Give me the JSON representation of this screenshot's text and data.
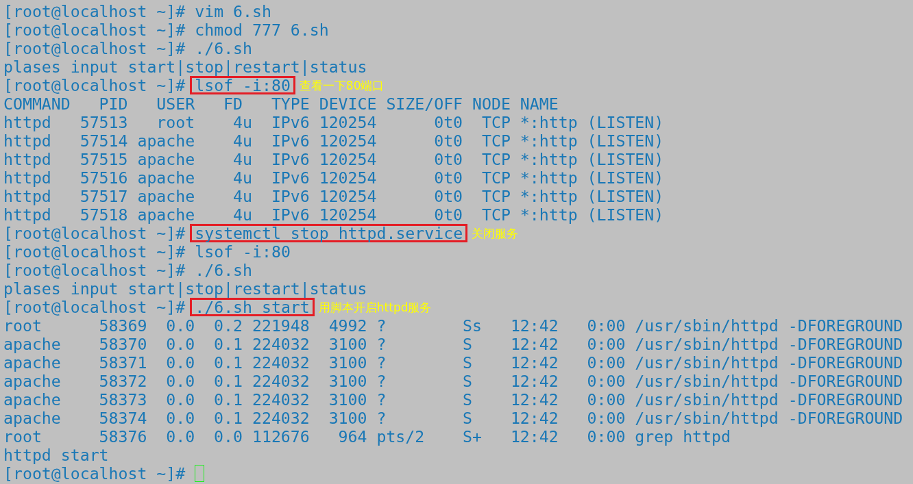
{
  "terminal": {
    "lines": [
      {
        "kind": "prompt",
        "prompt": "[root@localhost ~]#",
        "command": "vim 6.sh",
        "highlighted": false
      },
      {
        "kind": "prompt",
        "prompt": "[root@localhost ~]#",
        "command": "chmod 777 6.sh",
        "highlighted": false
      },
      {
        "kind": "prompt",
        "prompt": "[root@localhost ~]#",
        "command": "./6.sh",
        "highlighted": false
      },
      {
        "kind": "output",
        "text": "plases input start|stop|restart|status"
      },
      {
        "kind": "prompt",
        "prompt": "[root@localhost ~]#",
        "command": "lsof -i:80",
        "highlighted": true,
        "annotation": "查看一下80端口"
      },
      {
        "kind": "output",
        "text": "COMMAND   PID   USER   FD   TYPE DEVICE SIZE/OFF NODE NAME"
      },
      {
        "kind": "output",
        "text": "httpd   57513   root    4u  IPv6 120254      0t0  TCP *:http (LISTEN)"
      },
      {
        "kind": "output",
        "text": "httpd   57514 apache    4u  IPv6 120254      0t0  TCP *:http (LISTEN)"
      },
      {
        "kind": "output",
        "text": "httpd   57515 apache    4u  IPv6 120254      0t0  TCP *:http (LISTEN)"
      },
      {
        "kind": "output",
        "text": "httpd   57516 apache    4u  IPv6 120254      0t0  TCP *:http (LISTEN)"
      },
      {
        "kind": "output",
        "text": "httpd   57517 apache    4u  IPv6 120254      0t0  TCP *:http (LISTEN)"
      },
      {
        "kind": "output",
        "text": "httpd   57518 apache    4u  IPv6 120254      0t0  TCP *:http (LISTEN)"
      },
      {
        "kind": "prompt",
        "prompt": "[root@localhost ~]#",
        "command": "systemctl stop httpd.service",
        "highlighted": true,
        "annotation": "关闭服务"
      },
      {
        "kind": "prompt",
        "prompt": "[root@localhost ~]#",
        "command": "lsof -i:80",
        "highlighted": false
      },
      {
        "kind": "prompt",
        "prompt": "[root@localhost ~]#",
        "command": "./6.sh",
        "highlighted": false
      },
      {
        "kind": "output",
        "text": "plases input start|stop|restart|status"
      },
      {
        "kind": "prompt",
        "prompt": "[root@localhost ~]#",
        "command": "./6.sh start",
        "highlighted": true,
        "annotation": "用脚本开启httpd服务"
      },
      {
        "kind": "output",
        "text": "root      58369  0.0  0.2 221948  4992 ?        Ss   12:42   0:00 /usr/sbin/httpd -DFOREGROUND"
      },
      {
        "kind": "output",
        "text": "apache    58370  0.0  0.1 224032  3100 ?        S    12:42   0:00 /usr/sbin/httpd -DFOREGROUND"
      },
      {
        "kind": "output",
        "text": "apache    58371  0.0  0.1 224032  3100 ?        S    12:42   0:00 /usr/sbin/httpd -DFOREGROUND"
      },
      {
        "kind": "output",
        "text": "apache    58372  0.0  0.1 224032  3100 ?        S    12:42   0:00 /usr/sbin/httpd -DFOREGROUND"
      },
      {
        "kind": "output",
        "text": "apache    58373  0.0  0.1 224032  3100 ?        S    12:42   0:00 /usr/sbin/httpd -DFOREGROUND"
      },
      {
        "kind": "output",
        "text": "apache    58374  0.0  0.1 224032  3100 ?        S    12:42   0:00 /usr/sbin/httpd -DFOREGROUND"
      },
      {
        "kind": "output",
        "text": "root      58376  0.0  0.0 112676   964 pts/2    S+   12:42   0:00 grep httpd"
      },
      {
        "kind": "output",
        "text": "httpd start"
      },
      {
        "kind": "input",
        "prompt": "[root@localhost ~]#"
      }
    ]
  }
}
